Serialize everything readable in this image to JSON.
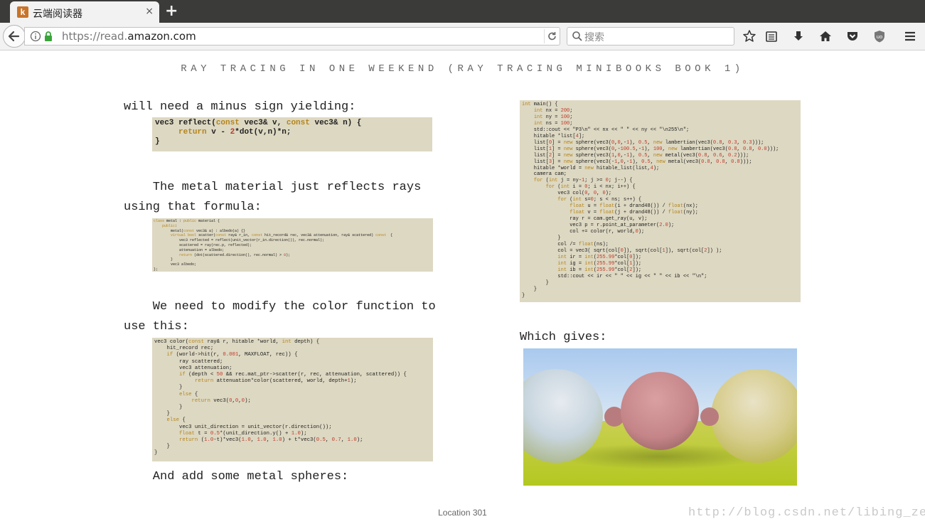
{
  "browser": {
    "tab_title": "云端阅读器",
    "tab_close": "×",
    "new_tab": "+",
    "url_scheme": "https://read.",
    "url_host": "amazon.com",
    "search_placeholder": "搜索",
    "toolbar_icons": [
      "star-icon",
      "reading-list-icon",
      "download-icon",
      "home-icon",
      "pocket-icon",
      "ublock-icon",
      "menu-icon"
    ]
  },
  "book": {
    "title": "RAY TRACING IN ONE WEEKEND (RAY TRACING MINIBOOKS BOOK 1)",
    "paragraphs": [
      "will need a minus sign yielding:",
      "    The metal material just reflects rays\nusing that formula:",
      "    We need to modify the color function to\nuse this:",
      "    And add some metal spheres:",
      "Which gives:"
    ],
    "code_reflect": "vec3 reflect(const vec3& v, const vec3& n) {\n     return v - 2*dot(v,n)*n;\n}",
    "code_metal": "class metal : public material {\n    public:\n        metal(const vec3& a) : albedo(a) {}\n        virtual bool scatter(const ray& r_in, const hit_record& rec, vec3& attenuation, ray& scattered) const  {\n            vec3 reflected = reflect(unit_vector(r_in.direction()), rec.normal);\n            scattered = ray(rec.p, reflected);\n            attenuation = albedo;\n            return (dot(scattered.direction(), rec.normal) > 0);\n        }\n        vec3 albedo;\n};",
    "code_color": "vec3 color(const ray& r, hitable *world, int depth) {\n    hit_record rec;\n    if (world->hit(r, 0.001, MAXFLOAT, rec)) {\n        ray scattered;\n        vec3 attenuation;\n        if (depth < 50 && rec.mat_ptr->scatter(r, rec, attenuation, scattered)) {\n             return attenuation*color(scattered, world, depth+1);\n        }\n        else {\n            return vec3(0,0,0);\n        }\n    }\n    else {\n        vec3 unit_direction = unit_vector(r.direction());\n        float t = 0.5*(unit_direction.y() + 1.0);\n        return (1.0-t)*vec3(1.0, 1.0, 1.0) + t*vec3(0.5, 0.7, 1.0);\n    }\n}",
    "code_main": "int main() {\n    int nx = 200;\n    int ny = 100;\n    int ns = 100;\n    std::cout << \"P3\\n\" << nx << \" \" << ny << \"\\n255\\n\";\n    hitable *list[4];\n    list[0] = new sphere(vec3(0,0,-1), 0.5, new lambertian(vec3(0.8, 0.3, 0.3)));\n    list[1] = new sphere(vec3(0,-100.5,-1), 100, new lambertian(vec3(0.8, 0.8, 0.0)));\n    list[2] = new sphere(vec3(1,0,-1), 0.5, new metal(vec3(0.8, 0.6, 0.2)));\n    list[3] = new sphere(vec3(-1,0,-1), 0.5, new metal(vec3(0.8, 0.8, 0.8)));\n    hitable *world = new hitable_list(list,4);\n    camera cam;\n    for (int j = ny-1; j >= 0; j--) {\n        for (int i = 0; i < nx; i++) {\n            vec3 col(0, 0, 0);\n            for (int s=0; s < ns; s++) {\n                float u = float(i + drand48()) / float(nx);\n                float v = float(j + drand48()) / float(ny);\n                ray r = cam.get_ray(u, v);\n                vec3 p = r.point_at_parameter(2.0);\n                col += color(r, world,0);\n            }\n            col /= float(ns);\n            col = vec3( sqrt(col[0]), sqrt(col[1]), sqrt(col[2]) );\n            int ir = int(255.99*col[0]);\n            int ig = int(255.99*col[1]);\n            int ib = int(255.99*col[2]);\n            std::cout << ir << \" \" << ig << \" \" << ib << \"\\n\";\n        }\n    }\n}",
    "location": "Location 301",
    "watermark": "http://blog.csdn.net/libing_zeng"
  },
  "colors": {
    "code_bg": "#ddd8c2",
    "keyword": "#b5841a",
    "number": "#c0392b",
    "tabbar": "#3b3b39"
  }
}
